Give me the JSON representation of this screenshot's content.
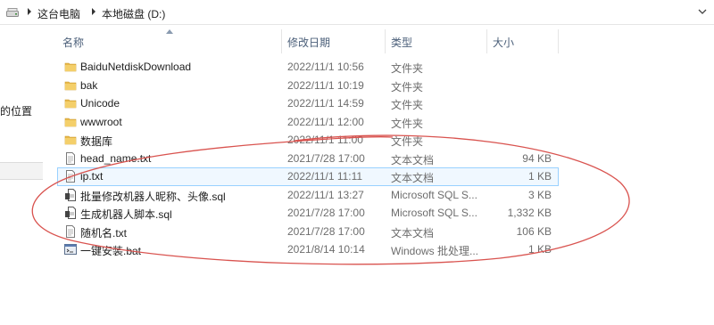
{
  "address_bar": {
    "breadcrumbs": [
      "这台电脑",
      "本地磁盘 (D:)"
    ],
    "drive_icon": "drive-icon",
    "dropdown_icon": "chevron-down-icon"
  },
  "nav_pane": {
    "partial_label": "的位置"
  },
  "columns": {
    "name": "名称",
    "modified": "修改日期",
    "type": "类型",
    "size": "大小"
  },
  "files": [
    {
      "name": "BaiduNetdiskDownload",
      "modified": "2022/11/1 10:56",
      "type": "文件夹",
      "size": "",
      "kind": "folder"
    },
    {
      "name": "bak",
      "modified": "2022/11/1 10:19",
      "type": "文件夹",
      "size": "",
      "kind": "folder"
    },
    {
      "name": "Unicode",
      "modified": "2022/11/1 14:59",
      "type": "文件夹",
      "size": "",
      "kind": "folder"
    },
    {
      "name": "wwwroot",
      "modified": "2022/11/1 12:00",
      "type": "文件夹",
      "size": "",
      "kind": "folder"
    },
    {
      "name": "数据库",
      "modified": "2022/11/1 11:00",
      "type": "文件夹",
      "size": "",
      "kind": "folder"
    },
    {
      "name": "head_name.txt",
      "modified": "2021/7/28 17:00",
      "type": "文本文档",
      "size": "94 KB",
      "kind": "txt"
    },
    {
      "name": "ip.txt",
      "modified": "2022/11/1 11:11",
      "type": "文本文档",
      "size": "1 KB",
      "kind": "txt"
    },
    {
      "name": "批量修改机器人昵称、头像.sql",
      "modified": "2022/11/1 13:27",
      "type": "Microsoft SQL S...",
      "size": "3 KB",
      "kind": "sql"
    },
    {
      "name": "生成机器人脚本.sql",
      "modified": "2021/7/28 17:00",
      "type": "Microsoft SQL S...",
      "size": "1,332 KB",
      "kind": "sql"
    },
    {
      "name": "随机名.txt",
      "modified": "2021/7/28 17:00",
      "type": "文本文档",
      "size": "106 KB",
      "kind": "txt"
    },
    {
      "name": "一键安装.bat",
      "modified": "2021/8/14 10:14",
      "type": "Windows 批处理...",
      "size": "1 KB",
      "kind": "bat"
    }
  ],
  "colors": {
    "folder": "#e8b84a",
    "annotation": "#d9534f",
    "header_text": "#4c607a",
    "selection": "#cce8ff"
  }
}
